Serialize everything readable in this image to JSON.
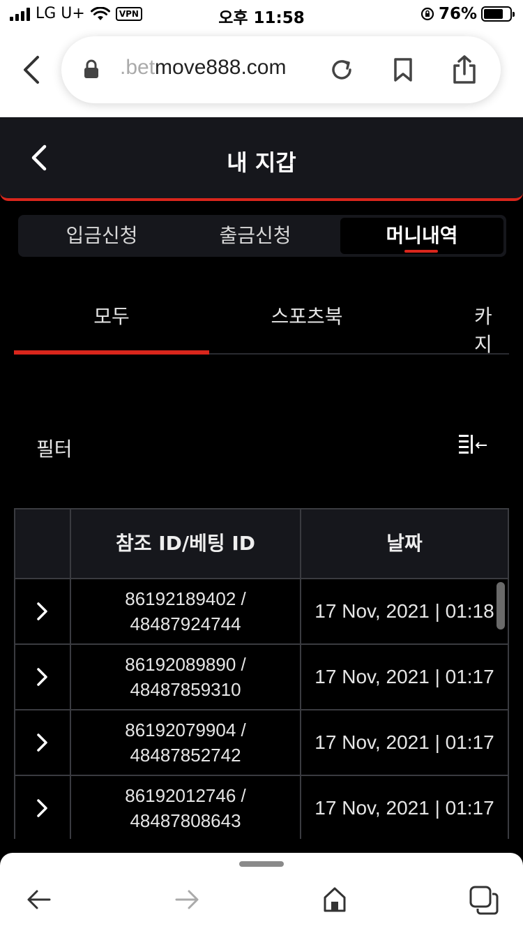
{
  "status_bar": {
    "carrier": "LG U+",
    "vpn": "VPN",
    "time": "오후 11:58",
    "battery": "76%",
    "battery_level": 0.76
  },
  "browser": {
    "url_faded": ".bet",
    "url_main": "move888.com"
  },
  "header": {
    "title": "내 지갑"
  },
  "segment_tabs": [
    {
      "label": "입금신청",
      "active": false
    },
    {
      "label": "출금신청",
      "active": false
    },
    {
      "label": "머니내역",
      "active": true
    }
  ],
  "sub_tabs": [
    {
      "label": "모두",
      "active": true
    },
    {
      "label": "스포츠북",
      "active": false
    },
    {
      "label": "카지",
      "active": false
    }
  ],
  "filter": {
    "label": "필터"
  },
  "table": {
    "headers": [
      "",
      "참조 ID/베팅 ID",
      "날짜"
    ],
    "rows": [
      {
        "ref_id": "86192189402 /",
        "bet_id": "48487924744",
        "date": "17 Nov, 2021 | 01:18"
      },
      {
        "ref_id": "86192089890 /",
        "bet_id": "48487859310",
        "date": "17 Nov, 2021 | 01:17"
      },
      {
        "ref_id": "86192079904 /",
        "bet_id": "48487852742",
        "date": "17 Nov, 2021 | 01:17"
      },
      {
        "ref_id": "86192012746 /",
        "bet_id": "48487808643",
        "date": "17 Nov, 2021 | 01:17"
      }
    ]
  },
  "colors": {
    "accent": "#d9261c",
    "background": "#000000",
    "panel": "#16171c",
    "border": "#3a3b40"
  }
}
